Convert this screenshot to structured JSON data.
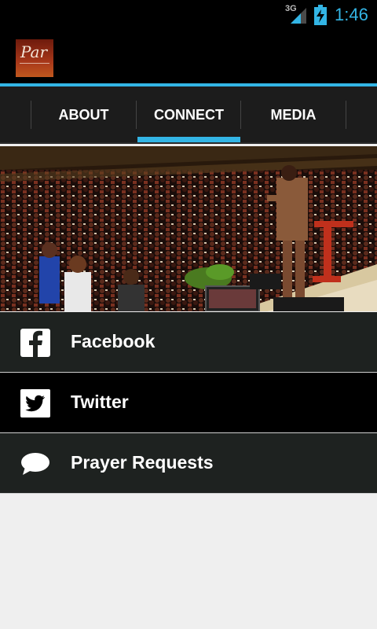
{
  "status_bar": {
    "network": "3G",
    "time": "1:46",
    "signal_icon": "signal-icon",
    "battery_icon": "battery-charging-icon",
    "accent": "#33b5e5"
  },
  "action_bar": {
    "logo_text": "Par",
    "logo_icon": "app-logo"
  },
  "tabs": [
    {
      "label": "ABOUT",
      "active": false
    },
    {
      "label": "CONNECT",
      "active": true
    },
    {
      "label": "MEDIA",
      "active": false
    }
  ],
  "hero": {
    "image": "church-congregation-photo"
  },
  "list_items": [
    {
      "label": "Facebook",
      "icon": "facebook-icon"
    },
    {
      "label": "Twitter",
      "icon": "twitter-icon"
    },
    {
      "label": "Prayer Requests",
      "icon": "speech-bubble-icon"
    }
  ],
  "colors": {
    "accent": "#33b5e5",
    "bar_background": "#000000",
    "tab_background": "#1c1c1c",
    "list_dark": "#1e2220"
  }
}
